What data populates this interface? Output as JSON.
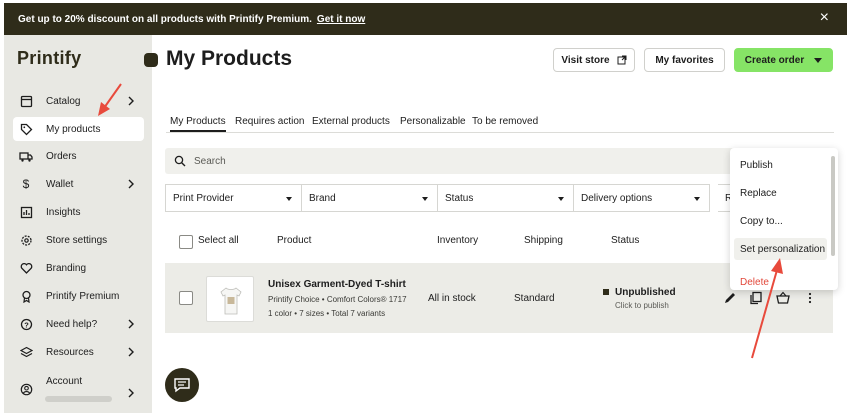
{
  "banner": {
    "text": "Get up to 20% discount on all products with Printify Premium.",
    "link": "Get it now",
    "close": "×"
  },
  "sidebar": {
    "logo": "Printify",
    "items": [
      {
        "label": "Catalog",
        "icon": "catalog-icon",
        "chevron": true
      },
      {
        "label": "My products",
        "icon": "tag-icon",
        "active": true
      },
      {
        "label": "Orders",
        "icon": "truck-icon"
      },
      {
        "label": "Wallet",
        "icon": "dollar-icon",
        "chevron": true
      },
      {
        "label": "Insights",
        "icon": "chart-icon"
      },
      {
        "label": "Store settings",
        "icon": "gear-icon"
      },
      {
        "label": "Branding",
        "icon": "heart-icon"
      },
      {
        "label": "Printify Premium",
        "icon": "badge-icon"
      },
      {
        "label": "Need help?",
        "icon": "help-icon",
        "chevron": true
      },
      {
        "label": "Resources",
        "icon": "stack-icon",
        "chevron": true
      },
      {
        "label": "Account",
        "icon": "user-icon",
        "chevron": true
      }
    ]
  },
  "header": {
    "title": "My Products",
    "visit_store": "Visit store",
    "my_favorites": "My favorites",
    "create_order": "Create order"
  },
  "tabs": [
    "My Products",
    "Requires action",
    "External products",
    "Personalizable",
    "To be removed"
  ],
  "search": {
    "placeholder": "Search"
  },
  "filters": [
    "Print Provider",
    "Brand",
    "Status",
    "Delivery options",
    "R"
  ],
  "table": {
    "select_all": "Select all",
    "columns": [
      "Product",
      "Inventory",
      "Shipping",
      "Status"
    ],
    "rows": [
      {
        "name": "Unisex Garment-Dyed T-shirt",
        "meta": "Printify Choice • Comfort Colors® 1717",
        "variants": "1 color • 7 sizes • Total 7 variants",
        "inventory": "All in stock",
        "shipping": "Standard",
        "status": "Unpublished",
        "status_sub": "Click to publish"
      }
    ]
  },
  "menu": {
    "items": [
      "Publish",
      "Replace",
      "Copy to...",
      "Set personalization",
      "Delete"
    ],
    "highlighted": "Set personalization"
  },
  "colors": {
    "banner_bg": "#2f2c1a",
    "sidebar_bg": "#e8e8e3",
    "accent_green": "#86e466",
    "danger": "#e2473a",
    "annotation_red": "#e84a3c"
  }
}
